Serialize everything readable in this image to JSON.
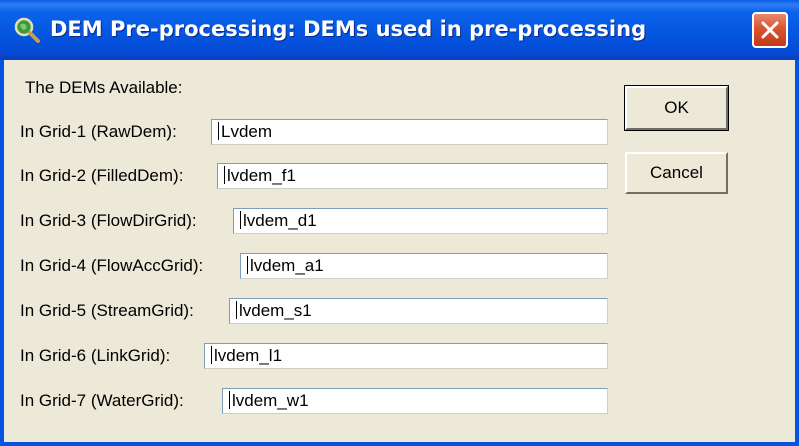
{
  "window": {
    "title": "DEM Pre-processing: DEMs used in pre-processing",
    "close_icon": "close-icon",
    "app_icon": "magnifier-globe-icon"
  },
  "dialog": {
    "available_label": "The DEMs Available:",
    "rows": [
      {
        "label": "In Grid-1 (RawDem):",
        "value": "Lvdem"
      },
      {
        "label": "In Grid-2 (FilledDem):",
        "value": "lvdem_f1"
      },
      {
        "label": "In Grid-3 (FlowDirGrid):",
        "value": "lvdem_d1"
      },
      {
        "label": "In Grid-4 (FlowAccGrid):",
        "value": "lvdem_a1"
      },
      {
        "label": "In Grid-5 (StreamGrid):",
        "value": "lvdem_s1"
      },
      {
        "label": "In Grid-6 (LinkGrid):",
        "value": "lvdem_l1"
      },
      {
        "label": "In Grid-7 (WaterGrid):",
        "value": "lvdem_w1"
      }
    ],
    "ok_label": "OK",
    "cancel_label": "Cancel"
  },
  "colors": {
    "titlebar": "#0454df",
    "dialog_bg": "#ece9d8",
    "close_button": "#d9532f"
  }
}
